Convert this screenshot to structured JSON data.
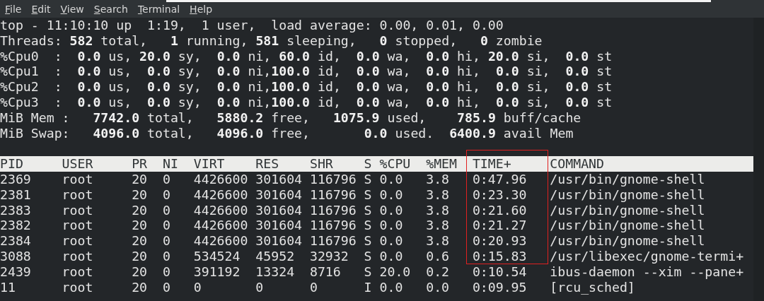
{
  "menu": [
    "File",
    "Edit",
    "View",
    "Search",
    "Terminal",
    "Help"
  ],
  "summary": [
    "top - 11:10:10 up  1:19,  1 user,  load average: 0.00, 0.01, 0.00",
    "Threads: **582** total,   **1** running, **581** sleeping,   **0** stopped,   **0** zombie",
    "%Cpu0  :  **0.0** us, **20.0** sy,  **0.0** ni, **60.0** id,  **0.0** wa,  **0.0** hi, **20.0** si,  **0.0** st",
    "%Cpu1  :  **0.0** us,  **0.0** sy,  **0.0** ni,**100.0** id,  **0.0** wa,  **0.0** hi,  **0.0** si,  **0.0** st",
    "%Cpu2  :  **0.0** us,  **0.0** sy,  **0.0** ni,**100.0** id,  **0.0** wa,  **0.0** hi,  **0.0** si,  **0.0** st",
    "%Cpu3  :  **0.0** us,  **0.0** sy,  **0.0** ni,**100.0** id,  **0.0** wa,  **0.0** hi,  **0.0** si,  **0.0** st",
    "MiB Mem :   **7742.0** total,   **5880.2** free,   **1075.9** used,    **785.9** buff/cache",
    "MiB Swap:   **4096.0** total,   **4096.0** free,       **0.0** used.  **6400.9** avail Mem"
  ],
  "table": {
    "columns": [
      {
        "label": "PID",
        "highlighted": false
      },
      {
        "label": "USER",
        "highlighted": false
      },
      {
        "label": "PR",
        "highlighted": false
      },
      {
        "label": "NI",
        "highlighted": false
      },
      {
        "label": "VIRT",
        "highlighted": false
      },
      {
        "label": "RES",
        "highlighted": false
      },
      {
        "label": "SHR",
        "highlighted": false
      },
      {
        "label": "S",
        "highlighted": false
      },
      {
        "label": "%CPU",
        "highlighted": false
      },
      {
        "label": "%MEM",
        "highlighted": false
      },
      {
        "label": "TIME+",
        "highlighted": true
      },
      {
        "label": "COMMAND",
        "highlighted": false
      }
    ],
    "rows": [
      [
        "2369",
        "root",
        "20",
        "0",
        "4426600",
        "301604",
        "116796",
        "S",
        "0.0",
        "3.8",
        "0:47.96",
        "/usr/bin/gnome-shell"
      ],
      [
        "2381",
        "root",
        "20",
        "0",
        "4426600",
        "301604",
        "116796",
        "S",
        "0.0",
        "3.8",
        "0:23.30",
        "/usr/bin/gnome-shell"
      ],
      [
        "2383",
        "root",
        "20",
        "0",
        "4426600",
        "301604",
        "116796",
        "S",
        "0.0",
        "3.8",
        "0:21.60",
        "/usr/bin/gnome-shell"
      ],
      [
        "2382",
        "root",
        "20",
        "0",
        "4426600",
        "301604",
        "116796",
        "S",
        "0.0",
        "3.8",
        "0:21.27",
        "/usr/bin/gnome-shell"
      ],
      [
        "2384",
        "root",
        "20",
        "0",
        "4426600",
        "301604",
        "116796",
        "S",
        "0.0",
        "3.8",
        "0:20.93",
        "/usr/bin/gnome-shell"
      ],
      [
        "3088",
        "root",
        "20",
        "0",
        "534524",
        "45952",
        "32932",
        "S",
        "0.0",
        "0.6",
        "0:15.83",
        "/usr/libexec/gnome-termi+"
      ],
      [
        "2439",
        "root",
        "20",
        "0",
        "391192",
        "13324",
        "8716",
        "S",
        "20.0",
        "0.2",
        "0:10.54",
        "ibus-daemon --xim --pane+"
      ],
      [
        "11",
        "root",
        "20",
        "0",
        "0",
        "0",
        "0",
        "I",
        "0.0",
        "0.0",
        "0:09.95",
        "[rcu_sched]"
      ]
    ]
  }
}
